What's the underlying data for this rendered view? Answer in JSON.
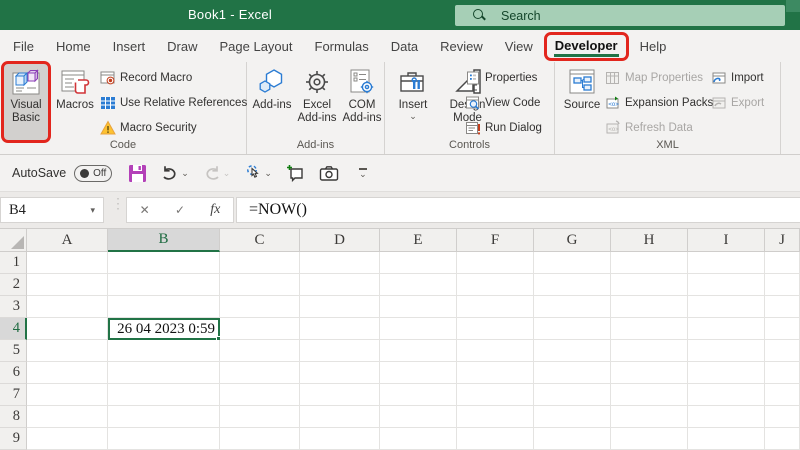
{
  "titlebar": {
    "title": "Book1 - Excel",
    "search_placeholder": "Search"
  },
  "tabs": [
    {
      "label": "File"
    },
    {
      "label": "Home"
    },
    {
      "label": "Insert"
    },
    {
      "label": "Draw"
    },
    {
      "label": "Page Layout"
    },
    {
      "label": "Formulas"
    },
    {
      "label": "Data"
    },
    {
      "label": "Review"
    },
    {
      "label": "View"
    },
    {
      "label": "Developer",
      "active": true,
      "highlighted": true
    },
    {
      "label": "Help"
    }
  ],
  "ribbon": {
    "groups": [
      {
        "label": "Code",
        "buttons": {
          "visual_basic": "Visual Basic",
          "macros": "Macros",
          "record_macro": "Record Macro",
          "use_relative_references": "Use Relative References",
          "macro_security": "Macro Security"
        }
      },
      {
        "label": "Add-ins",
        "buttons": {
          "addins": "Add-ins",
          "excel_addins": "Excel Add-ins",
          "com_addins": "COM Add-ins"
        }
      },
      {
        "label": "Controls",
        "buttons": {
          "insert": "Insert",
          "design_mode": "Design Mode",
          "properties": "Properties",
          "view_code": "View Code",
          "run_dialog": "Run Dialog"
        }
      },
      {
        "label": "XML",
        "buttons": {
          "source": "Source",
          "map_properties": "Map Properties",
          "expansion_packs": "Expansion Packs",
          "refresh_data": "Refresh Data",
          "import": "Import",
          "export": "Export"
        }
      }
    ]
  },
  "qat": {
    "autosave_label": "AutoSave",
    "autosave_state": "Off"
  },
  "formula_bar": {
    "name_box": "B4",
    "fx_label": "fx",
    "formula": "=NOW()"
  },
  "grid": {
    "columns": [
      "A",
      "B",
      "C",
      "D",
      "E",
      "F",
      "G",
      "H",
      "I",
      "J"
    ],
    "rows": [
      "1",
      "2",
      "3",
      "4",
      "5",
      "6",
      "7",
      "8",
      "9"
    ],
    "selected": {
      "column": "B",
      "row": "4",
      "value": "26 04 2023 0:59"
    }
  },
  "colors": {
    "brand_green": "#217346",
    "annotation_red": "#e2261d"
  }
}
